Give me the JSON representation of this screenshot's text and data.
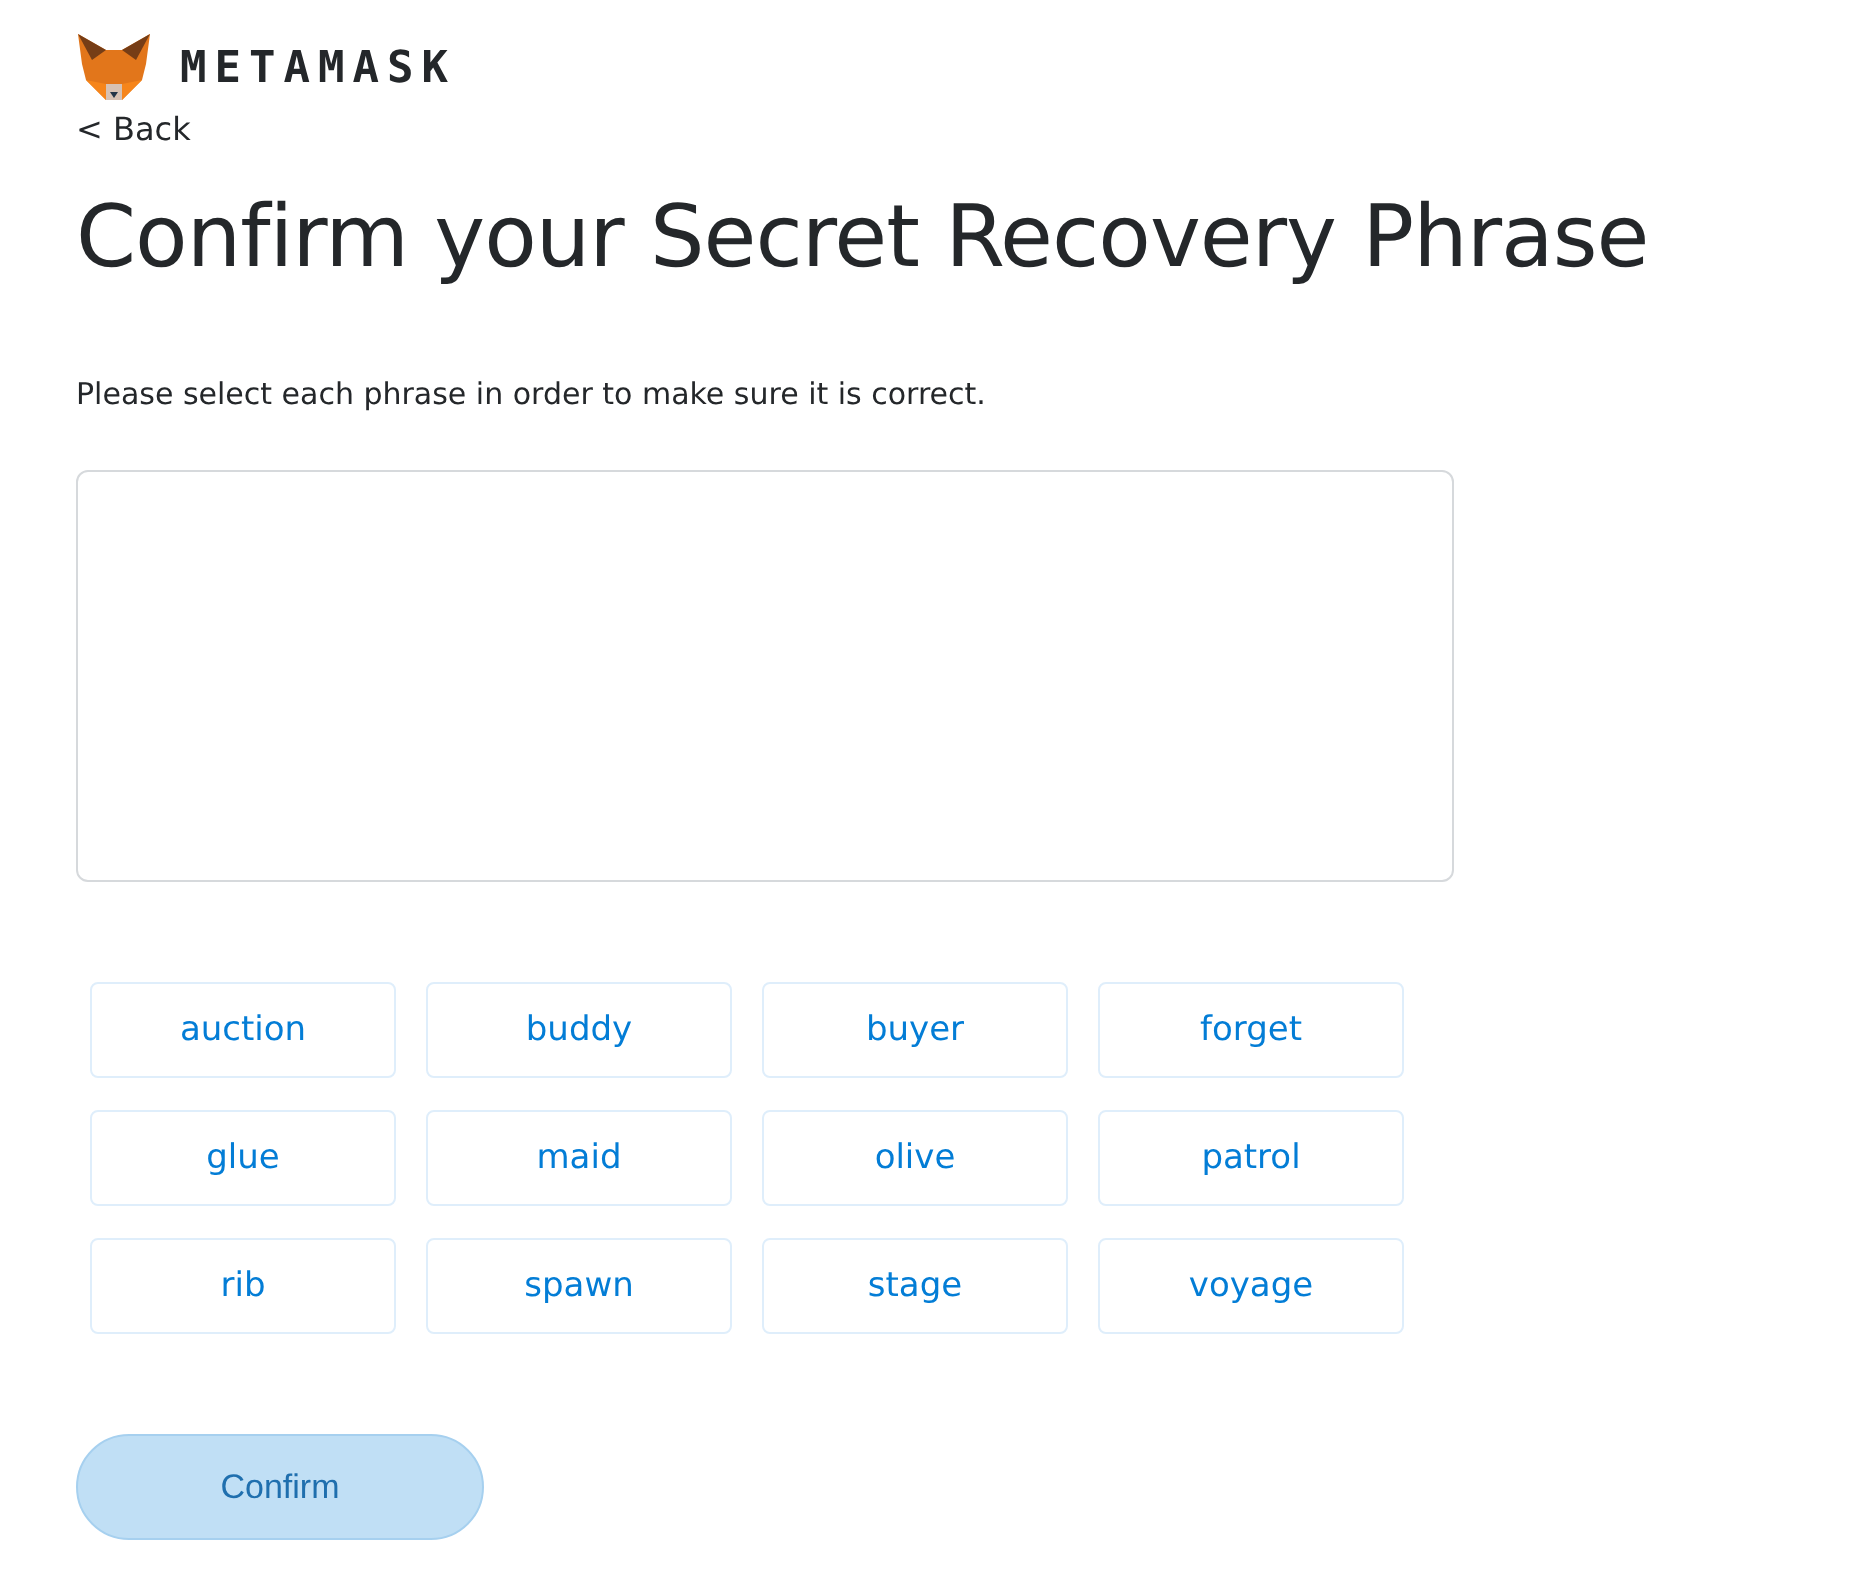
{
  "brand": {
    "name": "METAMASK"
  },
  "back_link": {
    "label": "< Back"
  },
  "title": "Confirm your Secret Recovery Phrase",
  "instructions": "Please select each phrase in order to make sure it is correct.",
  "words": [
    {
      "label": "auction",
      "selected": false
    },
    {
      "label": "buddy",
      "selected": false
    },
    {
      "label": "buyer",
      "selected": false
    },
    {
      "label": "forget",
      "selected": false
    },
    {
      "label": "glue",
      "selected": false
    },
    {
      "label": "maid",
      "selected": false
    },
    {
      "label": "olive",
      "selected": false
    },
    {
      "label": "patrol",
      "selected": false
    },
    {
      "label": "rib",
      "selected": false
    },
    {
      "label": "spawn",
      "selected": false
    },
    {
      "label": "stage",
      "selected": false
    },
    {
      "label": "voyage",
      "selected": false
    }
  ],
  "confirm_button": {
    "label": "Confirm",
    "disabled": true
  }
}
